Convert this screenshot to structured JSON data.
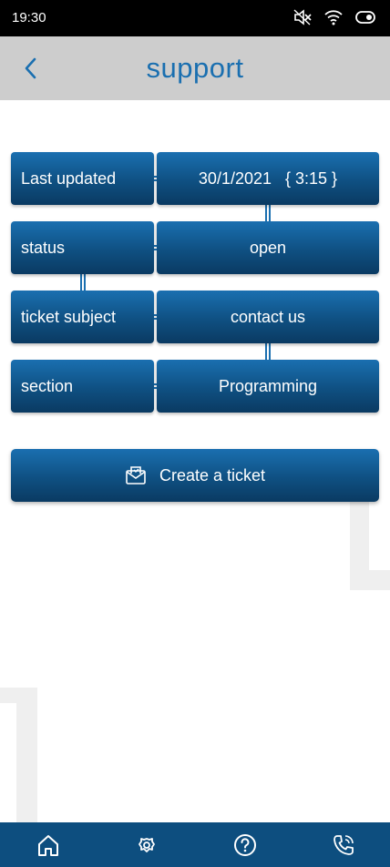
{
  "status_bar": {
    "time": "19:30"
  },
  "header": {
    "title": "support"
  },
  "ticket": {
    "rows": [
      {
        "label": "Last updated",
        "value": "30/1/2021   { 3:15 }"
      },
      {
        "label": "status",
        "value": "open"
      },
      {
        "label": "ticket subject",
        "value": "contact us"
      },
      {
        "label": "section",
        "value": "Programming"
      }
    ]
  },
  "actions": {
    "create_label": "Create a ticket"
  },
  "bottom_nav": {
    "items": [
      {
        "icon": "home-icon"
      },
      {
        "icon": "settings-icon"
      },
      {
        "icon": "help-icon"
      },
      {
        "icon": "phone-icon"
      }
    ]
  },
  "colors": {
    "accent": "#1a6fb0",
    "tile_dark": "#0a3a62",
    "nav": "#0d4e7f",
    "header": "#cdcdcd"
  }
}
